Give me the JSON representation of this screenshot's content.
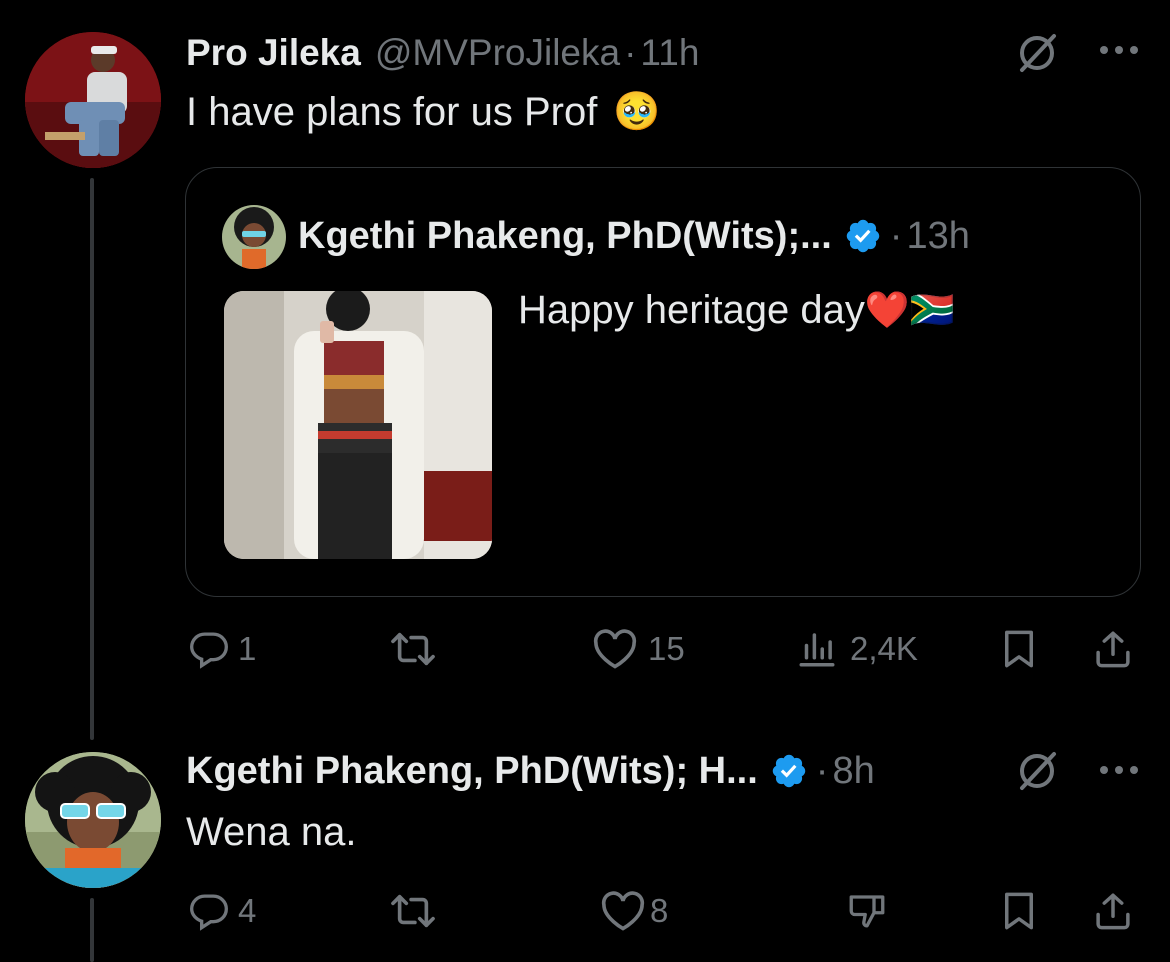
{
  "tweet1": {
    "display_name": "Pro Jileka",
    "handle": "@MVProJileka",
    "separator": "·",
    "time": "11h",
    "text": "I have plans for us Prof",
    "text_emoji": "🥹",
    "quote": {
      "display_name": "Kgethi Phakeng, PhD(Wits);...",
      "separator": "·",
      "time": "13h",
      "text": "Happy heritage day",
      "text_emoji": "❤️🇿🇦"
    },
    "actions": {
      "replies": "1",
      "reposts": "",
      "likes": "15",
      "views": "2,4K"
    }
  },
  "tweet2": {
    "display_name": "Kgethi Phakeng, PhD(Wits); H...",
    "separator": "·",
    "time": "8h",
    "text": "Wena na.",
    "actions": {
      "replies": "4",
      "reposts": "",
      "likes": "8"
    }
  },
  "colors": {
    "background": "#000000",
    "text": "#e7e9ea",
    "muted": "#71767b",
    "verified": "#1d9bf0",
    "divider": "#2f3336"
  },
  "icons": [
    "grok-slash-icon",
    "more-icon",
    "reply-icon",
    "repost-icon",
    "like-icon",
    "views-icon",
    "bookmark-icon",
    "share-icon",
    "downvote-icon",
    "verified-badge-icon"
  ]
}
